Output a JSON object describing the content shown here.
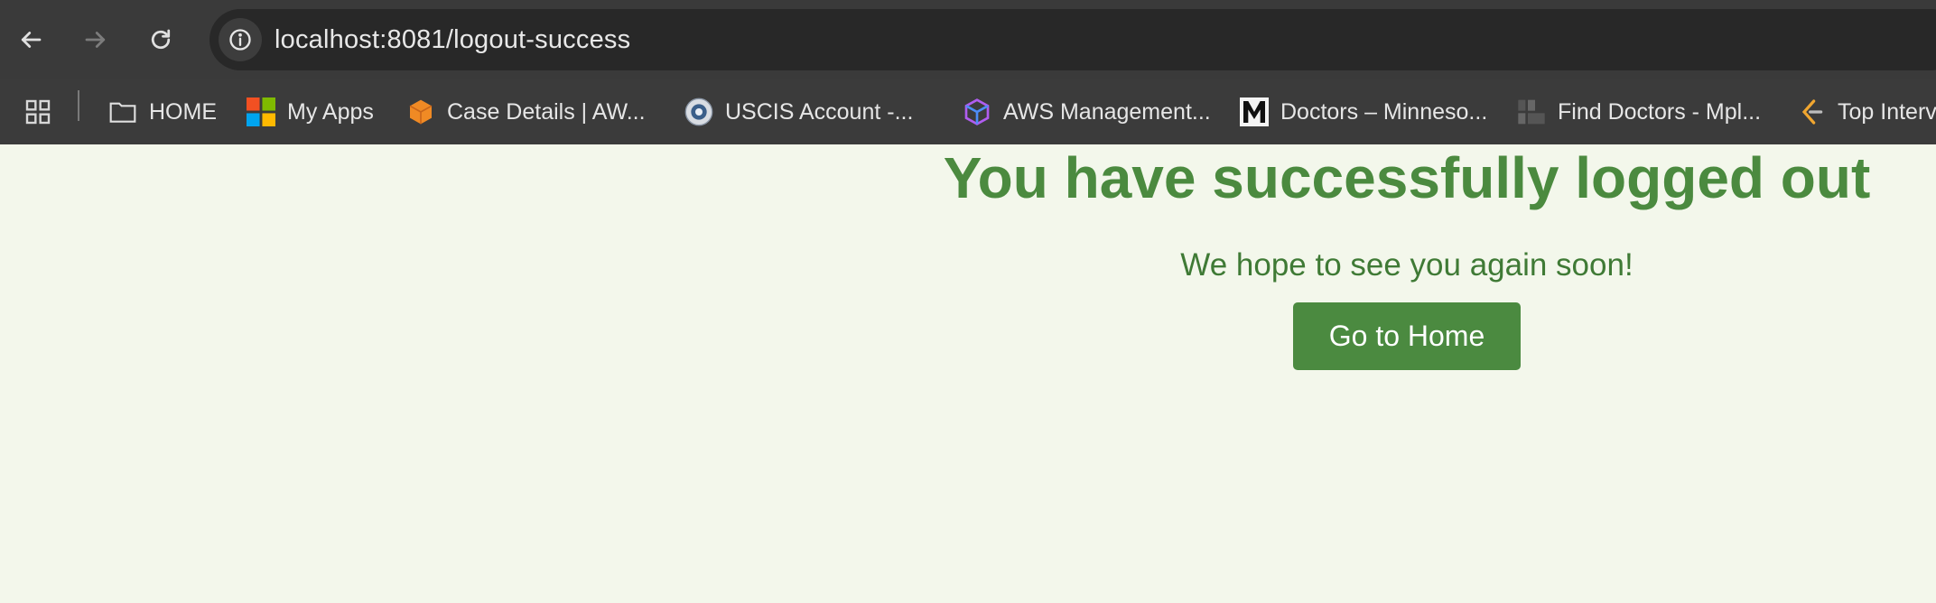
{
  "browser": {
    "url": "localhost:8081/logout-success",
    "bookmarks": [
      {
        "label": "HOME",
        "icon": "folder-icon"
      },
      {
        "label": "My Apps",
        "icon": "microsoft-logo-icon"
      },
      {
        "label": "Case Details | AW...",
        "icon": "aws-cube-icon"
      },
      {
        "label": "USCIS Account -...",
        "icon": "uscis-seal-icon"
      },
      {
        "label": "AWS Management...",
        "icon": "aws-console-cube-icon"
      },
      {
        "label": "Doctors – Minneso...",
        "icon": "m-logo-icon"
      },
      {
        "label": "Find Doctors - Mpl...",
        "icon": "mpls-stpaul-logo-icon"
      },
      {
        "label": "Top Interv",
        "icon": "leetcode-icon"
      }
    ]
  },
  "page": {
    "title": "You have successfully logged out",
    "subtitle": "We hope to see you again soon!",
    "button_label": "Go to Home"
  },
  "colors": {
    "page_background": "#f3f7eb",
    "heading": "#4b8a3f",
    "button_background": "#4b8a40",
    "chrome": "#3b3b3b"
  }
}
